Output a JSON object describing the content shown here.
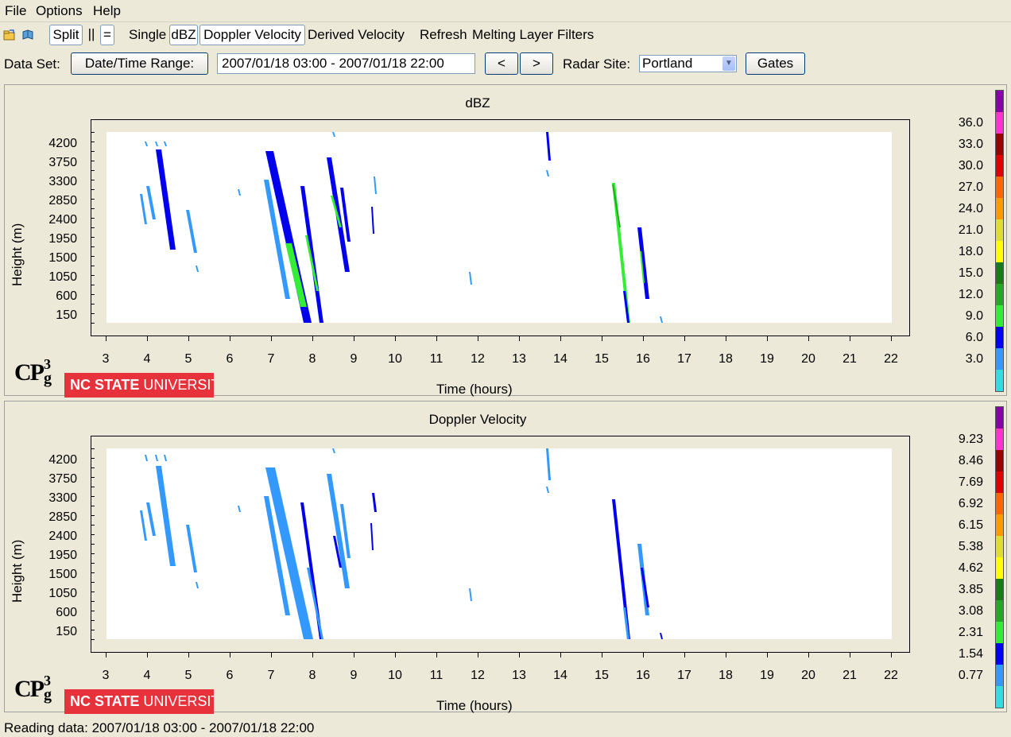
{
  "menu": {
    "file": "File",
    "options": "Options",
    "help": "Help"
  },
  "toolbar": {
    "split": "Split",
    "parallel": "||",
    "equal": "=",
    "single": "Single",
    "dbz": "dBZ",
    "doppler": "Doppler Velocity",
    "derived": "Derived Velocity",
    "refresh": "Refresh",
    "melting": "Melting Layer",
    "filters": "Filters"
  },
  "dataset": {
    "label": "Data Set:",
    "range_button": "Date/Time Range:",
    "range_value": "2007/01/18 03:00 - 2007/01/18 22:00",
    "prev": "<",
    "next": ">",
    "site_label": "Radar Site:",
    "site_value": "Portland",
    "gates": "Gates"
  },
  "logo": {
    "cp": "CP",
    "sup": "3",
    "sub": "g",
    "ncsu_bold": "NC STATE",
    "ncsu_light": "UNIVERSITY"
  },
  "status": "Reading data: 2007/01/18 03:00 - 2007/01/18 22:00",
  "chart_data": [
    {
      "type": "heatmap",
      "title": "dBZ",
      "xlabel": "Time (hours)",
      "ylabel": "Height (m)",
      "x_ticks": [
        "3",
        "4",
        "5",
        "6",
        "7",
        "8",
        "9",
        "10",
        "11",
        "12",
        "13",
        "14",
        "15",
        "16",
        "17",
        "18",
        "19",
        "20",
        "21",
        "22"
      ],
      "y_ticks": [
        "150",
        "600",
        "1050",
        "1500",
        "1950",
        "2400",
        "2850",
        "3300",
        "3750",
        "4200"
      ],
      "xlim": [
        3,
        22
      ],
      "ylim": [
        0,
        4500
      ],
      "colorbar_labels": [
        "36.0",
        "33.0",
        "30.0",
        "27.0",
        "24.0",
        "21.0",
        "18.0",
        "15.0",
        "12.0",
        "9.0",
        "6.0",
        "3.0"
      ],
      "colorbar_colors": [
        "#8800aa",
        "#ff33cc",
        "#990000",
        "#dd0000",
        "#ff6600",
        "#ff9900",
        "#dddd33",
        "#ffff00",
        "#1a7a1a",
        "#22aa22",
        "#33ee33",
        "#0000ee",
        "#3399ff",
        "#33dddd"
      ]
    },
    {
      "type": "heatmap",
      "title": "Doppler Velocity",
      "xlabel": "Time (hours)",
      "ylabel": "Height (m)",
      "x_ticks": [
        "3",
        "4",
        "5",
        "6",
        "7",
        "8",
        "9",
        "10",
        "11",
        "12",
        "13",
        "14",
        "15",
        "16",
        "17",
        "18",
        "19",
        "20",
        "21",
        "22"
      ],
      "y_ticks": [
        "150",
        "600",
        "1050",
        "1500",
        "1950",
        "2400",
        "2850",
        "3300",
        "3750",
        "4200"
      ],
      "xlim": [
        3,
        22
      ],
      "ylim": [
        0,
        4500
      ],
      "colorbar_labels": [
        "9.23",
        "8.46",
        "7.69",
        "6.92",
        "6.15",
        "5.38",
        "4.62",
        "3.85",
        "3.08",
        "2.31",
        "1.54",
        "0.77"
      ],
      "colorbar_colors": [
        "#8800aa",
        "#ff33cc",
        "#990000",
        "#dd0000",
        "#ff6600",
        "#ff9900",
        "#dddd33",
        "#ffff00",
        "#1a7a1a",
        "#22aa22",
        "#33ee33",
        "#0000ee",
        "#3399ff",
        "#33dddd"
      ]
    }
  ]
}
